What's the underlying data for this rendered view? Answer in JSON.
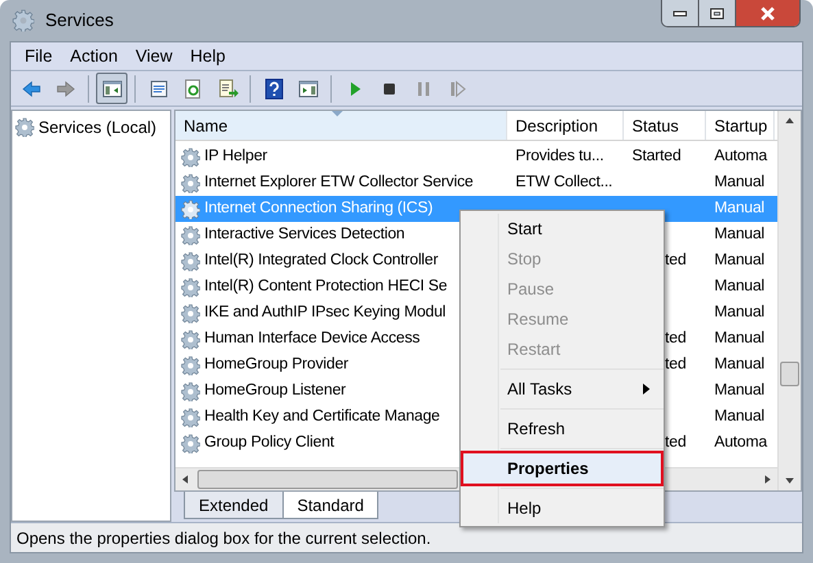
{
  "window": {
    "title": "Services"
  },
  "menu": [
    {
      "label": "File"
    },
    {
      "label": "Action"
    },
    {
      "label": "View"
    },
    {
      "label": "Help"
    }
  ],
  "toolbar": [
    {
      "kind": "back",
      "disabled": false
    },
    {
      "kind": "forward",
      "disabled": true
    },
    {
      "kind": "separator"
    },
    {
      "kind": "tree",
      "pressed": true
    },
    {
      "kind": "separator"
    },
    {
      "kind": "properties"
    },
    {
      "kind": "refresh"
    },
    {
      "kind": "export"
    },
    {
      "kind": "separator"
    },
    {
      "kind": "help"
    },
    {
      "kind": "actionpane"
    },
    {
      "kind": "separator"
    },
    {
      "kind": "start",
      "disabled": false
    },
    {
      "kind": "stop",
      "disabled": false
    },
    {
      "kind": "pause",
      "disabled": true
    },
    {
      "kind": "resume",
      "disabled": true
    }
  ],
  "tree": [
    {
      "label": "Services (Local)",
      "selected": false
    }
  ],
  "table": {
    "columns": [
      "Name",
      "Description",
      "Status",
      "Startup"
    ],
    "rows": [
      {
        "name": "IP Helper",
        "description": "Provides tu...",
        "status": "Started",
        "startup": "Automa",
        "selected": false
      },
      {
        "name": "Internet Explorer ETW Collector Service",
        "description": "ETW Collect...",
        "startup": "Manual",
        "selected": false
      },
      {
        "name": "Internet Connection Sharing (ICS)",
        "startup": "Manual",
        "selected": true
      },
      {
        "name": "Interactive Services Detection",
        "startup": "Manual",
        "selected": false
      },
      {
        "name": "Intel(R) Integrated Clock Controller",
        "status": "ted",
        "startup": "Manual",
        "selected": false
      },
      {
        "name": "Intel(R) Content Protection HECI Se",
        "startup": "Manual",
        "selected": false
      },
      {
        "name": "IKE and AuthIP IPsec Keying Modul",
        "startup": "Manual",
        "selected": false
      },
      {
        "name": "Human Interface Device Access",
        "status": "ted",
        "startup": "Manual",
        "selected": false
      },
      {
        "name": "HomeGroup Provider",
        "status": "ted",
        "startup": "Manual",
        "selected": false
      },
      {
        "name": "HomeGroup Listener",
        "startup": "Manual",
        "selected": false
      },
      {
        "name": "Health Key and Certificate Manage",
        "startup": "Manual",
        "selected": false
      },
      {
        "name": "Group Policy Client",
        "status": "ted",
        "startup": "Automa",
        "selected": false
      }
    ]
  },
  "tabs": [
    {
      "label": "Extended",
      "selected": false
    },
    {
      "label": "Standard",
      "selected": true
    }
  ],
  "context_menu": [
    {
      "kind": "item",
      "label": "Start",
      "disabled": false
    },
    {
      "kind": "item",
      "label": "Stop",
      "disabled": true
    },
    {
      "kind": "item",
      "label": "Pause",
      "disabled": true
    },
    {
      "kind": "item",
      "label": "Resume",
      "disabled": true
    },
    {
      "kind": "item",
      "label": "Restart",
      "disabled": true
    },
    {
      "kind": "separator"
    },
    {
      "kind": "submenu",
      "label": "All Tasks",
      "disabled": false
    },
    {
      "kind": "separator"
    },
    {
      "kind": "item",
      "label": "Refresh",
      "disabled": false
    },
    {
      "kind": "separator"
    },
    {
      "kind": "item",
      "label": "Properties",
      "disabled": false,
      "selected": true
    },
    {
      "kind": "separator"
    },
    {
      "kind": "item",
      "label": "Help",
      "disabled": false
    }
  ],
  "status_bar": "Opens the properties dialog box for the current selection."
}
